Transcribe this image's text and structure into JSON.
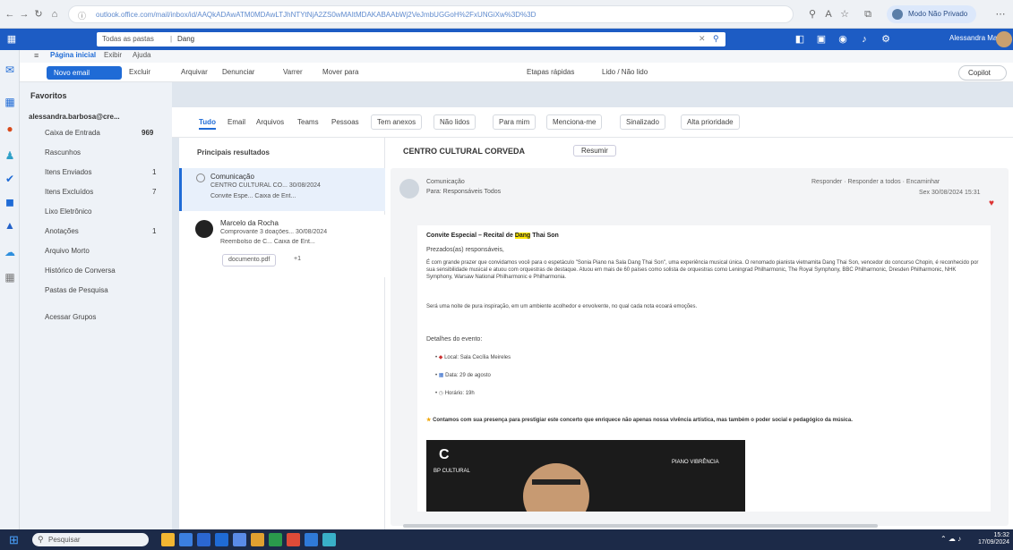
{
  "browser": {
    "url": "outlook.office.com/mail/inbox/id/AAQkADAwATM0MDAwLTJhNTYtNjA2ZS0wMAItMDAKABAAbWj2VeJmbUGGoH%2FxUNGiXw%3D%3D",
    "profile_label": "Modo Não Privado"
  },
  "appbar": {
    "search_scope": "Todas as pastas",
    "search_text": "Dang",
    "user_name": "Alessandra Marlei..."
  },
  "tabs": [
    "Página inicial",
    "Exibir",
    "Ajuda"
  ],
  "ribbon": {
    "new_mail": "Novo email",
    "buttons": [
      "Excluir",
      "Arquivar",
      "Denunciar",
      "Varrer",
      "Mover para",
      "Etapas rápidas",
      "Lido / Não lido"
    ],
    "copilot": "Copilot"
  },
  "folders": {
    "favorites": "Favoritos",
    "account": "alessandra.barbosa@cre...",
    "items": [
      {
        "label": "Caixa de Entrada",
        "count": "969"
      },
      {
        "label": "Rascunhos",
        "count": ""
      },
      {
        "label": "Itens Enviados",
        "count": "1"
      },
      {
        "label": "Itens Excluídos",
        "count": "7"
      },
      {
        "label": "Lixo Eletrônico",
        "count": ""
      },
      {
        "label": "Anotações",
        "count": "1"
      },
      {
        "label": "Arquivo Morto",
        "count": ""
      },
      {
        "label": "Histórico de Conversa",
        "count": ""
      },
      {
        "label": "Pastas de Pesquisa",
        "count": ""
      },
      {
        "label": "Acessar Grupos",
        "count": ""
      }
    ]
  },
  "filters": {
    "scopes": [
      "Tudo",
      "Email",
      "Arquivos",
      "Teams",
      "Pessoas"
    ],
    "chips": [
      "Tem anexos",
      "Não lidos",
      "Para mim",
      "Menciona-me",
      "Sinalizado",
      "Alta prioridade"
    ]
  },
  "messagelist": {
    "section": "Principais resultados",
    "messages": [
      {
        "sender": "Comunicação",
        "subject": "CENTRO CULTURAL CO... 30/08/2024",
        "preview": "Convite Espe... Caixa de Ent..."
      },
      {
        "sender": "Marcelo da Rocha",
        "subject": "Comprovante 3 doações... 30/08/2024",
        "preview": "Reembolso de C... Caixa de Ent...",
        "attachment": "documento.pdf",
        "extra": "+1"
      }
    ]
  },
  "reading": {
    "subject": "CENTRO CULTURAL CORVEDA",
    "summary_btn": "Resumir",
    "from": "Comunicação",
    "to": "Para: Responsáveis Todos",
    "actions": [
      "Responder",
      "Responder a todos",
      "Encaminhar"
    ],
    "date": "Sex 30/08/2024 15:31",
    "heading_pre": "Convite Especial – Recital de ",
    "heading_hl": "Dang",
    "heading_post": " Thai Son",
    "greeting": "Prezados(as) responsáveis,",
    "body_p1": "É com grande prazer que convidamos você para o espetáculo \"Sonia Piano na Sala Dang Thai Son\", uma experiência musical única. O renomado pianista vietnamita Dang Thai Son, vencedor do concurso Chopin, é reconhecido por sua sensibilidade musical e atuou com orquestras de destaque. Atuou em mais de 60 países como solista de orquestras como Leningrad Philharmonic, The Royal Symphony, BBC Philharmonic, Dresden Philharmonic, NHK Symphony, Warsaw National Philharmonic e Philharmonia.",
    "body_p2": "Será uma noite de pura inspiração, em um ambiente acolhedor e envolvente, no qual cada nota ecoará emoções.",
    "details_title": "Detalhes do evento:",
    "details": [
      "Local: Sala Cecília Meireles",
      "Data: 29 de agosto",
      "Horário: 19h"
    ],
    "closing": "Contamos com sua presença para prestigiar este concerto que enriquece não apenas nossa vivência artística, mas também o poder social e pedagógico da música.",
    "banner_left": "BP CULTURAL",
    "banner_right": "PIANO VIBRÊNCIA"
  },
  "taskbar": {
    "search": "Pesquisar",
    "time": "15:32",
    "date": "17/09/2024"
  }
}
